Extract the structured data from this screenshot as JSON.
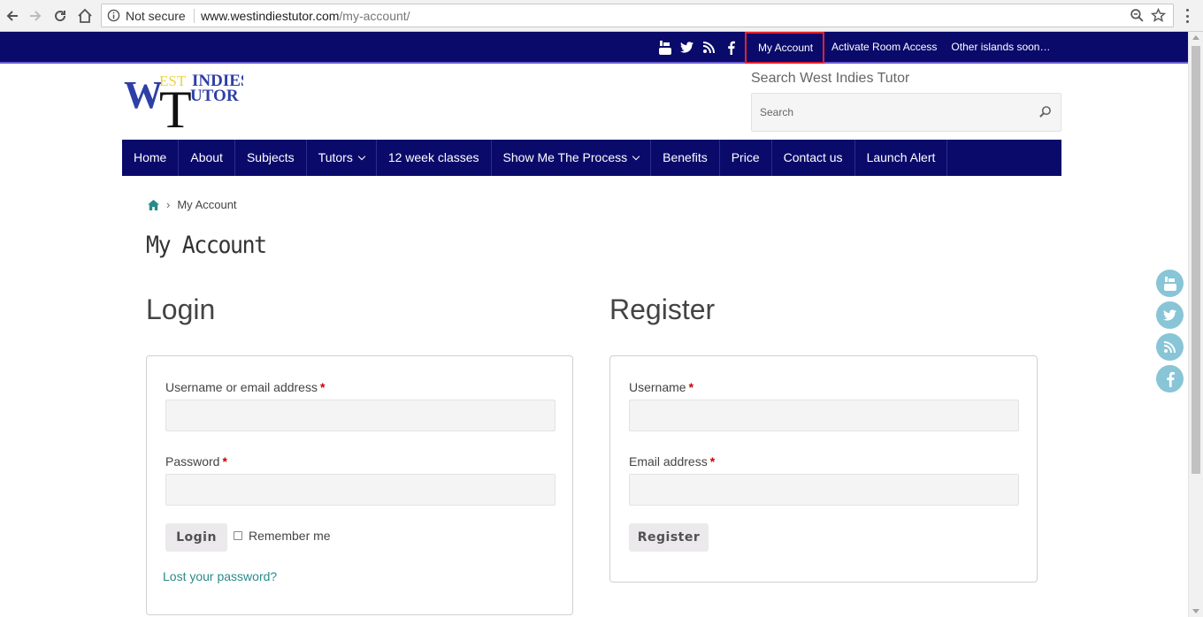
{
  "browser": {
    "security_label": "Not secure",
    "url_host": "www.westindiestutor.com",
    "url_path": "/my-account/"
  },
  "topbar": {
    "social_icons": [
      "youtube-icon",
      "twitter-icon",
      "rss-icon",
      "facebook-icon"
    ],
    "links": [
      "My Account",
      "Activate Room Access",
      "Other islands soon…"
    ]
  },
  "header": {
    "search_label": "Search West Indies Tutor",
    "search_placeholder": "Search",
    "logo_text_est": "EST",
    "logo_text_indies": "INDIES",
    "logo_text_utor": "UTOR",
    "logo_text_w": "W",
    "logo_text_t": "T"
  },
  "nav": {
    "items": [
      {
        "label": "Home",
        "dropdown": false
      },
      {
        "label": "About",
        "dropdown": false
      },
      {
        "label": "Subjects",
        "dropdown": false
      },
      {
        "label": "Tutors",
        "dropdown": true
      },
      {
        "label": "12 week classes",
        "dropdown": false
      },
      {
        "label": "Show Me The Process",
        "dropdown": true
      },
      {
        "label": "Benefits",
        "dropdown": false
      },
      {
        "label": "Price",
        "dropdown": false
      },
      {
        "label": "Contact us",
        "dropdown": false
      },
      {
        "label": "Launch Alert",
        "dropdown": false
      }
    ]
  },
  "breadcrumb": {
    "current": "My Account"
  },
  "page": {
    "title": "My Account"
  },
  "login": {
    "title": "Login",
    "username_label": "Username or email address",
    "password_label": "Password",
    "required_mark": "*",
    "submit_label": "Login",
    "remember_label": "Remember me",
    "lost_password": "Lost your password?"
  },
  "register": {
    "title": "Register",
    "username_label": "Username",
    "email_label": "Email address",
    "required_mark": "*",
    "submit_label": "Register"
  },
  "colors": {
    "nav_bg": "#0a0a6b",
    "highlight_border": "#e3212d",
    "link_teal": "#2a8a8a",
    "float_icon_bg": "#88c5d6"
  }
}
